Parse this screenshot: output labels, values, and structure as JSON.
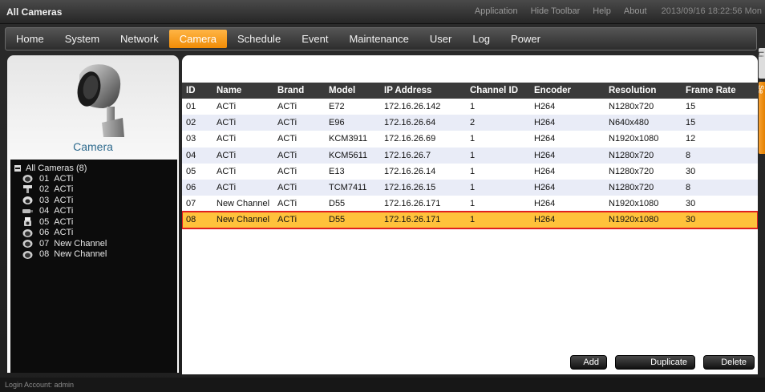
{
  "window": {
    "title": "All Cameras"
  },
  "toplinks": {
    "application": "Application",
    "hide_toolbar": "Hide Toolbar",
    "help": "Help",
    "about": "About",
    "datetime": "2013/09/16 18:22:56 Mon"
  },
  "menu": {
    "items": [
      {
        "label": "Home"
      },
      {
        "label": "System"
      },
      {
        "label": "Network"
      },
      {
        "label": "Camera"
      },
      {
        "label": "Schedule"
      },
      {
        "label": "Event"
      },
      {
        "label": "Maintenance"
      },
      {
        "label": "User"
      },
      {
        "label": "Log"
      },
      {
        "label": "Power"
      }
    ],
    "active": "Camera",
    "accent": "#f5960f"
  },
  "left": {
    "caption": "Camera",
    "tree_root": "All Cameras (8)",
    "tree": [
      {
        "id": "01",
        "name": "ACTi",
        "icon": "dome-camera-icon"
      },
      {
        "id": "02",
        "name": "ACTi",
        "icon": "bullet-camera-icon"
      },
      {
        "id": "03",
        "name": "ACTi",
        "icon": "dome-camera-icon"
      },
      {
        "id": "04",
        "name": "ACTi",
        "icon": "box-camera-icon"
      },
      {
        "id": "05",
        "name": "ACTi",
        "icon": "cube-camera-icon"
      },
      {
        "id": "06",
        "name": "ACTi",
        "icon": "dome-camera-icon"
      },
      {
        "id": "07",
        "name": "New Channel",
        "icon": "dome-camera-icon"
      },
      {
        "id": "08",
        "name": "New Channel",
        "icon": "dome-camera-icon"
      }
    ]
  },
  "table": {
    "columns": [
      "ID",
      "Name",
      "Brand",
      "Model",
      "IP Address",
      "Channel ID",
      "Encoder",
      "Resolution",
      "Frame Rate"
    ],
    "rows": [
      [
        "01",
        "ACTi",
        "ACTi",
        "E72",
        "172.16.26.142",
        "1",
        "H264",
        "N1280x720",
        "15"
      ],
      [
        "02",
        "ACTi",
        "ACTi",
        "E96",
        "172.16.26.64",
        "2",
        "H264",
        "N640x480",
        "15"
      ],
      [
        "03",
        "ACTi",
        "ACTi",
        "KCM3911",
        "172.16.26.69",
        "1",
        "H264",
        "N1920x1080",
        "12"
      ],
      [
        "04",
        "ACTi",
        "ACTi",
        "KCM5611",
        "172.16.26.7",
        "1",
        "H264",
        "N1280x720",
        "8"
      ],
      [
        "05",
        "ACTi",
        "ACTi",
        "E13",
        "172.16.26.14",
        "1",
        "H264",
        "N1280x720",
        "30"
      ],
      [
        "06",
        "ACTi",
        "ACTi",
        "TCM7411",
        "172.16.26.15",
        "1",
        "H264",
        "N1280x720",
        "8"
      ],
      [
        "07",
        "New Channel",
        "ACTi",
        "D55",
        "172.16.26.171",
        "1",
        "H264",
        "N1920x1080",
        "30"
      ],
      [
        "08",
        "New Channel",
        "ACTi",
        "D55",
        "172.16.26.171",
        "1",
        "H264",
        "N1920x1080",
        "30"
      ]
    ],
    "selected_row": "08"
  },
  "buttons": {
    "add": "Add",
    "duplicate": "Duplicate",
    "delete": "Delete"
  },
  "status": {
    "login": "Login Account: admin"
  }
}
